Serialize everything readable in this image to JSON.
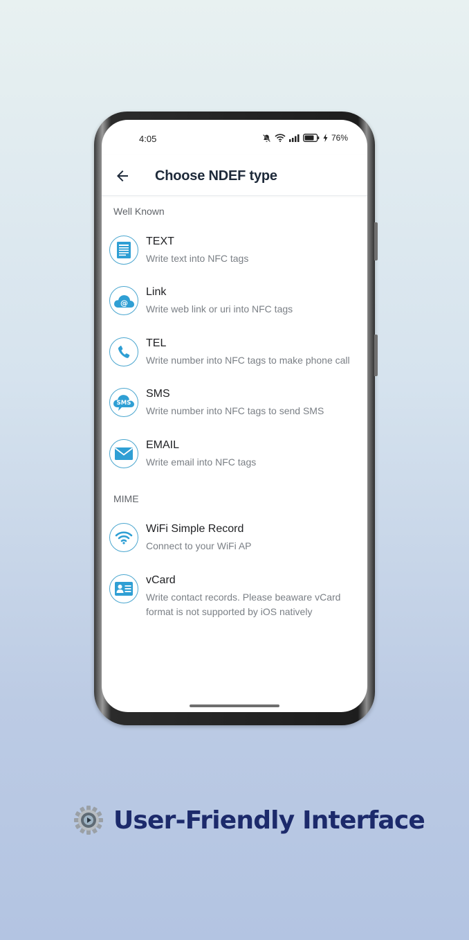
{
  "status": {
    "time": "4:05",
    "battery": "76%"
  },
  "appbar": {
    "title": "Choose NDEF type"
  },
  "sections": {
    "well_known": "Well Known",
    "mime": "MIME"
  },
  "items": [
    {
      "title": "TEXT",
      "subtitle": "Write text into NFC tags",
      "icon": "document-icon"
    },
    {
      "title": "Link",
      "subtitle": "Write web link or uri into NFC tags",
      "icon": "at-cloud-icon"
    },
    {
      "title": "TEL",
      "subtitle": "Write number into NFC tags to make phone call",
      "icon": "phone-icon"
    },
    {
      "title": "SMS",
      "subtitle": "Write number into NFC tags to send SMS",
      "icon": "sms-cloud-icon"
    },
    {
      "title": "EMAIL",
      "subtitle": "Write email into NFC tags",
      "icon": "envelope-icon"
    },
    {
      "title": "WiFi Simple Record",
      "subtitle": "Connect to your WiFi AP",
      "icon": "wifi-icon"
    },
    {
      "title": "vCard",
      "subtitle": "Write contact records. Please beaware vCard format is not supported by iOS natively",
      "icon": "contact-card-icon"
    }
  ],
  "caption": "User-Friendly Interface",
  "colors": {
    "accent": "#2f9fd4",
    "caption": "#1c2a6b"
  }
}
